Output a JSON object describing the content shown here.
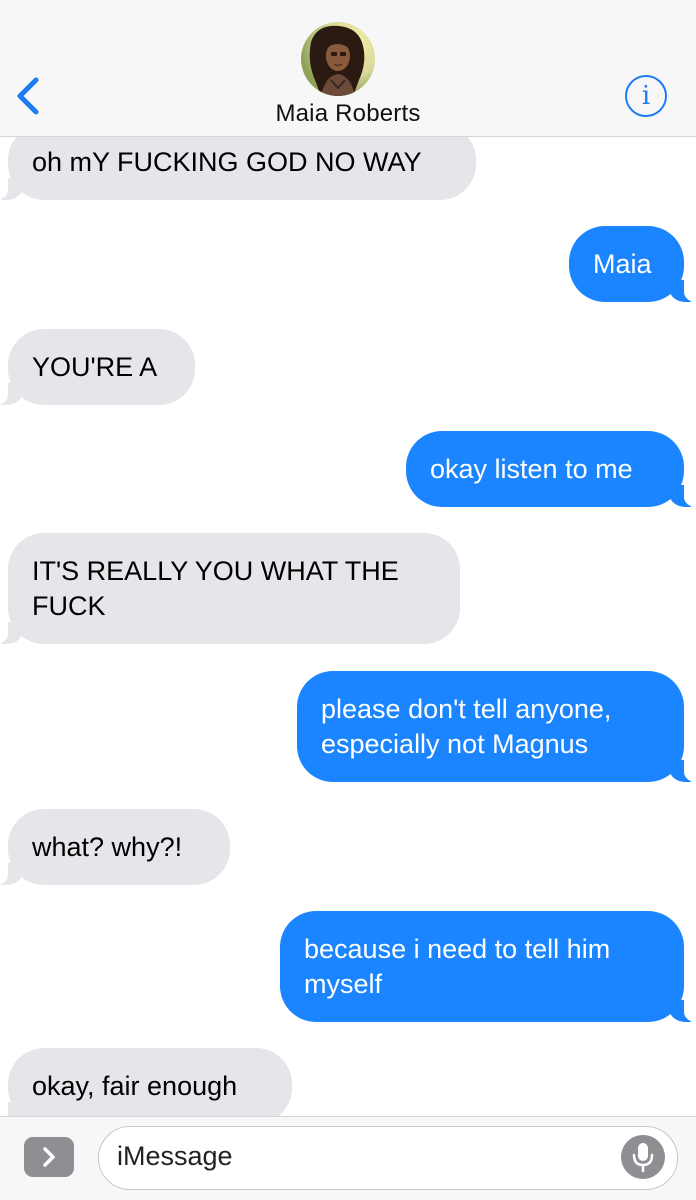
{
  "header": {
    "contact_name": "Maia Roberts",
    "info_glyph": "i",
    "back_icon": "chevron-left-icon",
    "accent": "#1d7cf2"
  },
  "thread": {
    "messages": [
      {
        "from": "them",
        "text": "oh mY FUCKING GOD NO WAY"
      },
      {
        "from": "me",
        "text": "Maia"
      },
      {
        "from": "them",
        "text": "YOU'RE A"
      },
      {
        "from": "me",
        "text": "okay listen to me"
      },
      {
        "from": "them",
        "text": "IT'S REALLY YOU WHAT THE FUCK"
      },
      {
        "from": "me",
        "text": "please don't tell anyone, especially not Magnus"
      },
      {
        "from": "them",
        "text": "what? why?!"
      },
      {
        "from": "me",
        "text": "because i need to tell him myself"
      },
      {
        "from": "them",
        "text": "okay, fair enough"
      }
    ],
    "incoming_color": "#e5e5ea",
    "outgoing_color": "#1a85ff"
  },
  "composer": {
    "placeholder": "iMessage",
    "apps_icon": "chevron-right-icon",
    "mic_icon": "microphone-icon"
  }
}
